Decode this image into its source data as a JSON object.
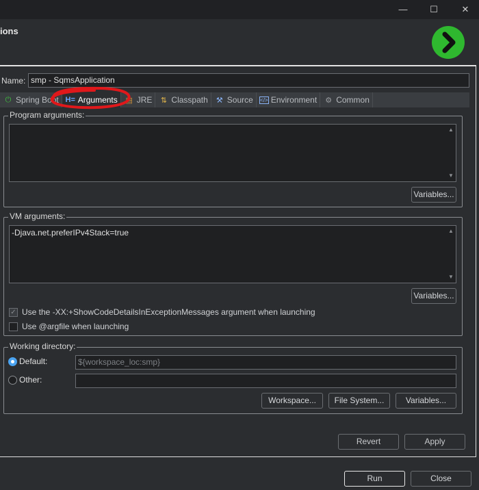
{
  "window": {
    "minimize_glyph": "—",
    "maximize_glyph": "☐",
    "close_glyph": "✕"
  },
  "header": {
    "title": "ions",
    "badge_color": "#2fb82f"
  },
  "name": {
    "label": "Name:",
    "value": "smp - SqmsApplication"
  },
  "tabs": [
    {
      "label": "Spring Boot",
      "icon": "power-icon",
      "active": false
    },
    {
      "label": "Arguments",
      "icon": "arguments-icon",
      "active": true
    },
    {
      "label": "JRE",
      "icon": "jre-icon",
      "active": false
    },
    {
      "label": "Classpath",
      "icon": "classpath-icon",
      "active": false
    },
    {
      "label": "Source",
      "icon": "source-icon",
      "active": false
    },
    {
      "label": "Environment",
      "icon": "environment-icon",
      "active": false
    },
    {
      "label": "Common",
      "icon": "gear-icon",
      "active": false
    }
  ],
  "program_arguments": {
    "label": "Program arguments:",
    "value": "",
    "variables_label": "Variables..."
  },
  "vm_arguments": {
    "label": "VM arguments:",
    "value": "-Djava.net.preferIPv4Stack=true",
    "variables_label": "Variables..."
  },
  "options": {
    "show_code_details_label": "Use the -XX:+ShowCodeDetailsInExceptionMessages argument when launching",
    "show_code_details_checked": true,
    "argfile_label": "Use @argfile when launching",
    "argfile_checked": false
  },
  "working_directory": {
    "label": "Working directory:",
    "default_label": "Default:",
    "default_value": "${workspace_loc:smp}",
    "other_label": "Other:",
    "other_value": "",
    "workspace_button": "Workspace...",
    "file_system_button": "File System...",
    "variables_button": "Variables..."
  },
  "actions": {
    "revert_label": "Revert",
    "apply_label": "Apply",
    "run_label": "Run",
    "close_label": "Close"
  },
  "annotation_color": "#e0181b"
}
